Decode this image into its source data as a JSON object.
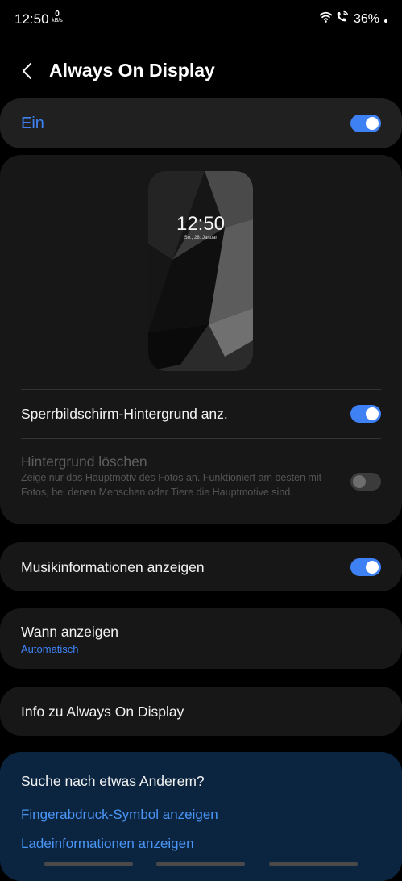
{
  "status_bar": {
    "time": "12:50",
    "data_rate_value": "0",
    "data_rate_unit": "kB/s",
    "battery": "36%",
    "icons": [
      "wifi-icon",
      "wifi-calling-icon"
    ]
  },
  "header": {
    "back_icon": "chevron-left-icon",
    "title": "Always On Display"
  },
  "master_switch": {
    "label": "Ein",
    "on": true
  },
  "preview": {
    "time": "12:50",
    "date": "So., 28. Januar"
  },
  "settings": {
    "lockscreen_wallpaper": {
      "label": "Sperrbildschirm-Hintergrund anz.",
      "on": true
    },
    "remove_background": {
      "label": "Hintergrund löschen",
      "description": "Zeige nur das Hauptmotiv des Fotos an. Funktioniert am besten mit Fotos, bei denen Menschen oder Tiere die Hauptmotive sind.",
      "on": false,
      "enabled": false
    },
    "music_info": {
      "label": "Musikinformationen anzeigen",
      "on": true
    },
    "when_to_show": {
      "label": "Wann anzeigen",
      "value": "Automatisch"
    },
    "about": {
      "label": "Info zu Always On Display"
    }
  },
  "suggestions": {
    "question": "Suche nach etwas Anderem?",
    "links": [
      "Fingerabdruck-Symbol anzeigen",
      "Ladeinformationen anzeigen"
    ]
  },
  "colors": {
    "accent": "#3e81f4",
    "card": "#171717",
    "suggestion_bg": "#0b2540"
  }
}
